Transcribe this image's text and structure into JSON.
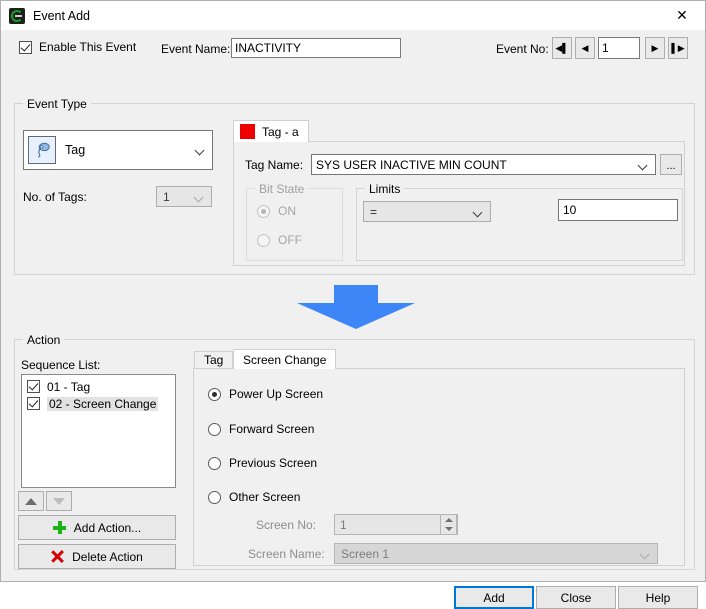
{
  "window": {
    "title": "Event Add",
    "icon": "app-icon",
    "close_label": "✕"
  },
  "header": {
    "enable_label": "Enable This Event",
    "enable_checked": true,
    "event_name_label": "Event Name:",
    "event_name_value": "INACTIVITY",
    "event_no_label": "Event No:",
    "event_no_value": "1",
    "nav_first": "◀▌",
    "nav_prev": "◀",
    "nav_next": "▶",
    "nav_last": "▌▶"
  },
  "event_type": {
    "legend": "Event Type",
    "type_value": "Tag",
    "no_of_tags_label": "No. of Tags:",
    "no_of_tags_value": "1",
    "tab_label": "Tag - a",
    "tab_color": "#ee0000",
    "tag_name_label": "Tag Name:",
    "tag_name_value": "SYS USER INACTIVE MIN COUNT",
    "browse_label": "...",
    "bit_state": {
      "legend": "Bit State",
      "on_label": "ON",
      "off_label": "OFF",
      "selected": "ON",
      "disabled": true
    },
    "limits": {
      "legend": "Limits",
      "operator_value": "=",
      "value": "10"
    }
  },
  "flow_arrow": {
    "name": "down-arrow",
    "color": "#3d86f7"
  },
  "action": {
    "legend": "Action",
    "sequence_label": "Sequence List:",
    "sequence_items": [
      {
        "label": "01 - Tag",
        "checked": true,
        "selected": false
      },
      {
        "label": "02 - Screen Change",
        "checked": true,
        "selected": true
      }
    ],
    "move_up_label": "▲",
    "move_down_label": "▼",
    "add_action_label": "Add Action...",
    "delete_action_label": "Delete Action",
    "tabs": [
      {
        "label": "Tag",
        "active": false
      },
      {
        "label": "Screen Change",
        "active": true
      }
    ],
    "screen_change": {
      "options": [
        {
          "label": "Power Up Screen",
          "selected": true
        },
        {
          "label": "Forward Screen",
          "selected": false
        },
        {
          "label": "Previous Screen",
          "selected": false
        },
        {
          "label": "Other Screen",
          "selected": false
        }
      ],
      "screen_no_label": "Screen No:",
      "screen_no_value": "1",
      "screen_name_label": "Screen Name:",
      "screen_name_value": "Screen 1",
      "disabled": true
    }
  },
  "footer": {
    "add_label": "Add",
    "close_label": "Close",
    "help_label": "Help"
  }
}
